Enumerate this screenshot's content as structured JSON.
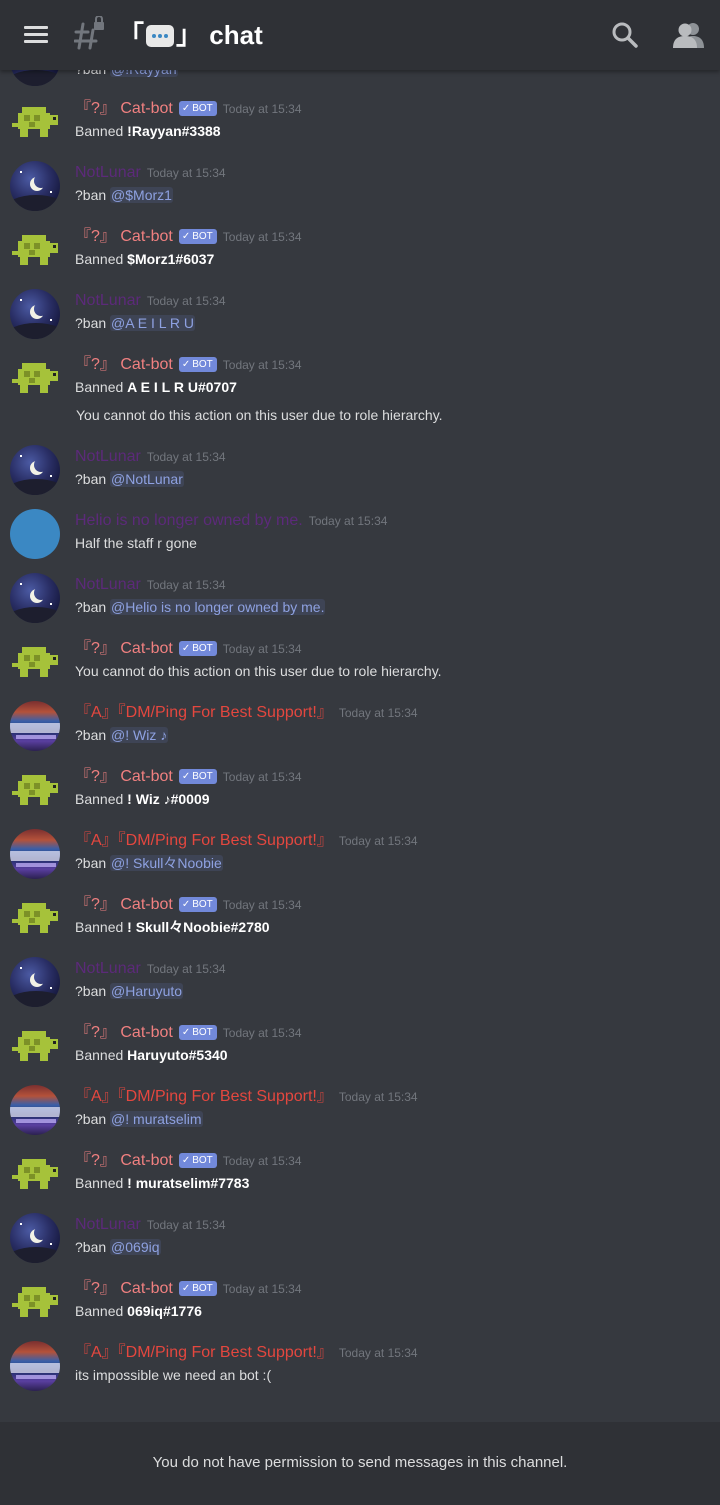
{
  "header": {
    "channel_title": "chat",
    "channel_brackets_left": "「",
    "channel_brackets_right": "」"
  },
  "names": {
    "catbot_prefix": "『?』",
    "catbot": "Cat-bot",
    "bot_tag": "BOT",
    "lunar": "NotLunar",
    "helio": "Helio is no longer owned by me.",
    "support": "『A』『DM/Ping For Best Support!』"
  },
  "time": "Today at 15:34",
  "messages": {
    "m0": {
      "prefix": "?ban ",
      "mention": "@!Rayyan"
    },
    "m1": {
      "prefix": "Banned ",
      "bold": "!Rayyan#3388"
    },
    "m2": {
      "prefix": "?ban ",
      "mention": "@$Morz1"
    },
    "m3": {
      "prefix": "Banned ",
      "bold": "$Morz1#6037"
    },
    "m4": {
      "prefix": "?ban ",
      "mention": "@A E I L R U"
    },
    "m5": {
      "prefix": "Banned ",
      "bold": "A E I L R U#0707",
      "extra": "You cannot do this action on this user due to role hierarchy."
    },
    "m6": {
      "prefix": "?ban ",
      "mention": "@NotLunar"
    },
    "m7": {
      "text": "Half the staff r gone"
    },
    "m8": {
      "prefix": "?ban ",
      "mention": "@Helio is no longer owned by me."
    },
    "m9": {
      "text": "You cannot do this action on this user due to role hierarchy."
    },
    "m10": {
      "prefix": "?ban ",
      "mention": "@! Wiz ♪"
    },
    "m11": {
      "prefix": "Banned ",
      "bold": "! Wiz ♪#0009"
    },
    "m12": {
      "prefix": "?ban ",
      "mention": "@! Skull々Noobie"
    },
    "m13": {
      "prefix": "Banned ",
      "bold": "! Skull々Noobie#2780"
    },
    "m14": {
      "prefix": "?ban ",
      "mention": "@Haruyuto"
    },
    "m15": {
      "prefix": "Banned ",
      "bold": "Haruyuto#5340"
    },
    "m16": {
      "prefix": "?ban ",
      "mention": "@! muratselim"
    },
    "m17": {
      "prefix": "Banned ",
      "bold": "! muratselim#7783"
    },
    "m18": {
      "prefix": "?ban ",
      "mention": "@069iq"
    },
    "m19": {
      "prefix": "Banned ",
      "bold": "069iq#1776"
    },
    "m20": {
      "text": "its impossible we need an bot :("
    }
  },
  "footer": {
    "notice": "You do not have permission to send messages in this channel."
  },
  "colors": {
    "background": "#36393f",
    "topbar": "#2f3136",
    "catbot": "#f08080",
    "support": "#e4473f",
    "lunar": "#5c2a7a",
    "bot_tag": "#7289da",
    "mention": "#8ea1e1"
  }
}
